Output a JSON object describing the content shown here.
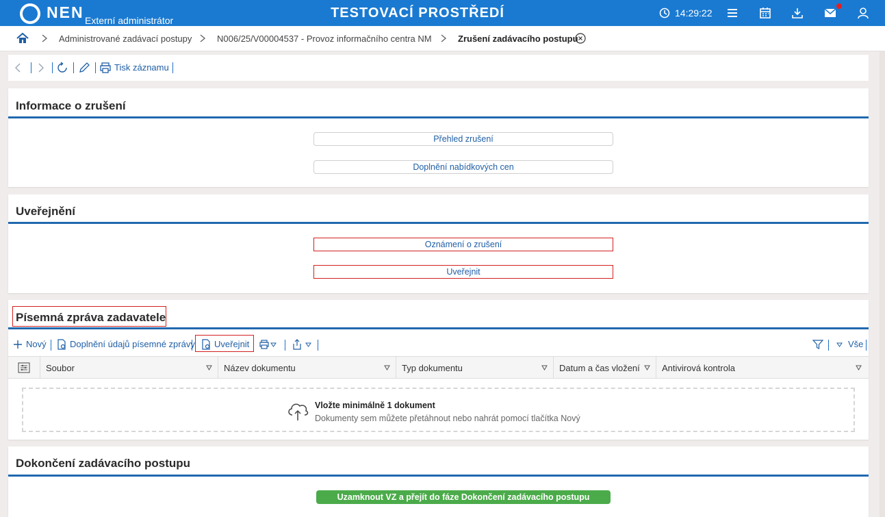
{
  "header": {
    "logo_text": "NEN",
    "logo_subtitle": "Externí administrátor",
    "environment_title": "TESTOVACÍ PROSTŘEDÍ",
    "time": "14:29:22",
    "accent_color": "#1a7ad1",
    "icons": [
      "clock-icon",
      "menu-icon",
      "calendar-icon",
      "download-icon",
      "mail-icon",
      "user-icon"
    ]
  },
  "breadcrumb": {
    "items": [
      "Administrované zadávací postupy",
      "N006/25/V00004537 - Provoz informačního centra NM",
      "Zrušení zadávacího postupu"
    ]
  },
  "record_toolbar": {
    "print_label": "Tisk záznamu"
  },
  "sections": {
    "info": {
      "title": "Informace o zrušení",
      "buttons": [
        "Přehled zrušení",
        "Doplnění nabídkových cen"
      ]
    },
    "publish": {
      "title": "Uveřejnění",
      "buttons": [
        "Oznámení o zrušení",
        "Uveřejnit"
      ]
    },
    "report": {
      "title": "Písemná zpráva zadavatele",
      "toolbar": {
        "new_label": "Nový",
        "supplement_label": "Doplnění údajů písemné zprávy",
        "publish_label": "Uveřejnit",
        "filter_all_label": "Vše"
      },
      "columns": [
        "Soubor",
        "Název dokumentu",
        "Typ dokumentu",
        "Datum a čas vložení",
        "Antivirová kontrola"
      ],
      "empty_title": "Vložte minimálně 1 dokument",
      "empty_hint": "Dokumenty sem můžete přetáhnout nebo nahrát pomocí tlačítka Nový"
    },
    "finish": {
      "title": "Dokončení zadávacího postupu",
      "button": "Uzamknout VZ a přejít do fáze Dokončení zadávacího postupu"
    }
  },
  "colors": {
    "link": "#1f5fa6",
    "highlight_border": "#d21f1f",
    "section_underline": "#2068b0",
    "success_button": "#4bab4a"
  }
}
